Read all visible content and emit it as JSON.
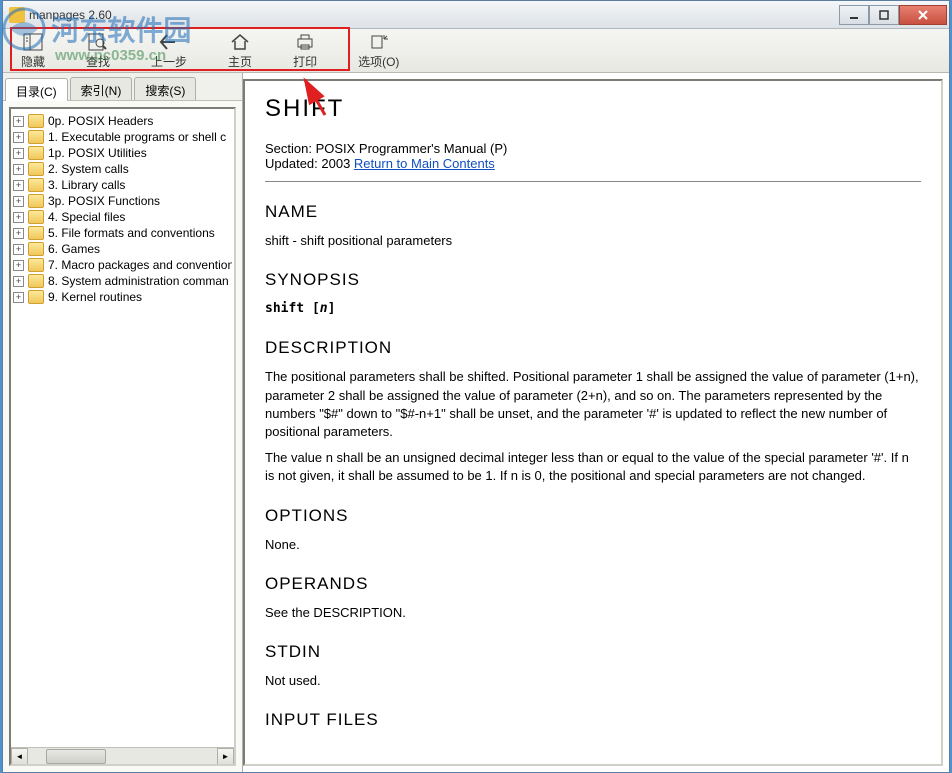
{
  "window": {
    "title": "manpages 2.60"
  },
  "watermark": {
    "text": "河东软件园",
    "url": "www.pc0359.cn"
  },
  "toolbar": {
    "hide": "隐藏",
    "find": "查找",
    "back": "上一步",
    "home": "主页",
    "print": "打印",
    "options": "选项(O)"
  },
  "tabs": {
    "contents": "目录(C)",
    "index": "索引(N)",
    "search": "搜索(S)"
  },
  "tree": [
    "0p. POSIX Headers",
    "1. Executable programs or shell c",
    "1p. POSIX Utilities",
    "2. System calls",
    "3. Library calls",
    "3p. POSIX Functions",
    "4. Special files",
    "5. File formats and conventions",
    "6. Games",
    "7. Macro packages and convention",
    "8. System administration comman",
    "9. Kernel routines"
  ],
  "doc": {
    "title": "SHIFT",
    "section": "Section: POSIX Programmer's Manual (P)",
    "updated_prefix": "Updated: 2003 ",
    "return_link": "Return to Main Contents",
    "h_name": "NAME",
    "name_text": "shift - shift positional parameters",
    "h_synopsis": "SYNOPSIS",
    "synopsis_text": "shift [n]",
    "h_description": "DESCRIPTION",
    "desc1": "The positional parameters shall be shifted. Positional parameter 1 shall be assigned the value of parameter (1+n), parameter 2 shall be assigned the value of parameter (2+n), and so on. The parameters represented by the numbers \"$#\" down to \"$#-n+1\" shall be unset, and the parameter '#' is updated to reflect the new number of positional parameters.",
    "desc2": "The value n shall be an unsigned decimal integer less than or equal to the value of the special parameter '#'. If n is not given, it shall be assumed to be 1. If n is 0, the positional and special parameters are not changed.",
    "h_options": "OPTIONS",
    "options_text": "None.",
    "h_operands": "OPERANDS",
    "operands_text": "See the DESCRIPTION.",
    "h_stdin": "STDIN",
    "stdin_text": "Not used.",
    "h_inputfiles": "INPUT FILES"
  }
}
